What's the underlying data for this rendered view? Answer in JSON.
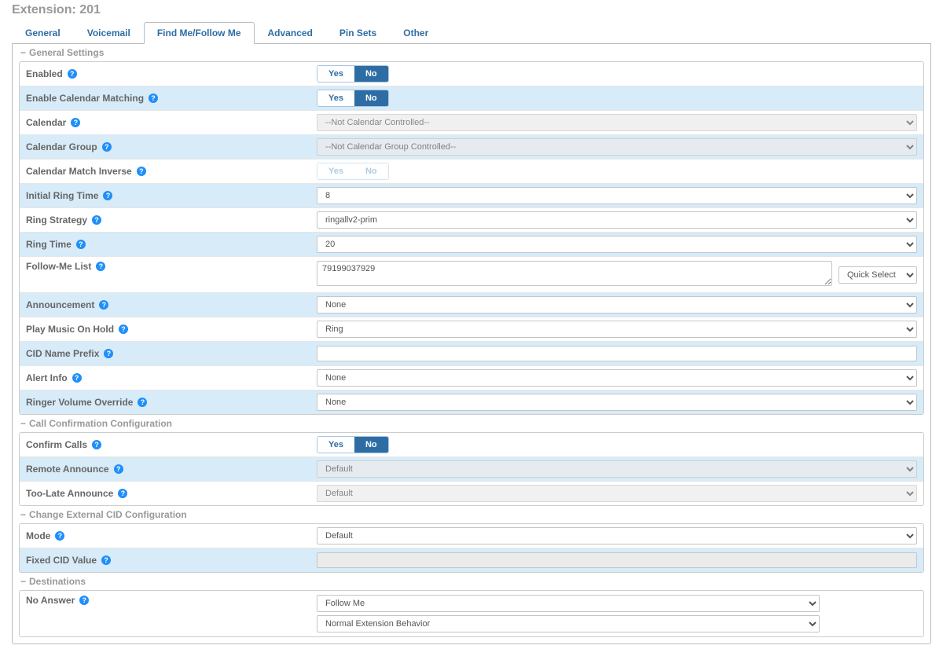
{
  "page_title": "Extension: 201",
  "tabs": {
    "general": "General",
    "voicemail": "Voicemail",
    "findme": "Find Me/Follow Me",
    "advanced": "Advanced",
    "pinsets": "Pin Sets",
    "other": "Other"
  },
  "yn": {
    "yes": "Yes",
    "no": "No"
  },
  "sections": {
    "general": {
      "title": "General Settings",
      "enabled": "Enabled",
      "cal_match": "Enable Calendar Matching",
      "calendar": "Calendar",
      "calendar_val": "--Not Calendar Controlled--",
      "cal_group": "Calendar Group",
      "cal_group_val": "--Not Calendar Group Controlled--",
      "cal_inverse": "Calendar Match Inverse",
      "init_ring": "Initial Ring Time",
      "init_ring_val": "8",
      "ring_strategy": "Ring Strategy",
      "ring_strategy_val": "ringallv2-prim",
      "ring_time": "Ring Time",
      "ring_time_val": "20",
      "follow_list": "Follow-Me List",
      "follow_list_val": "79199037929",
      "quick_select": "Quick Select",
      "announcement": "Announcement",
      "announcement_val": "None",
      "moh": "Play Music On Hold",
      "moh_val": "Ring",
      "cid_prefix": "CID Name Prefix",
      "cid_prefix_val": "",
      "alert_info": "Alert Info",
      "alert_info_val": "None",
      "ringer_vol": "Ringer Volume Override",
      "ringer_vol_val": "None"
    },
    "confirm": {
      "title": "Call Confirmation Configuration",
      "confirm_calls": "Confirm Calls",
      "remote_announce": "Remote Announce",
      "remote_announce_val": "Default",
      "toolate": "Too-Late Announce",
      "toolate_val": "Default"
    },
    "extcid": {
      "title": "Change External CID Configuration",
      "mode": "Mode",
      "mode_val": "Default",
      "fixed_cid": "Fixed CID Value",
      "fixed_cid_val": ""
    },
    "dest": {
      "title": "Destinations",
      "no_answer": "No Answer",
      "no_answer_val1": "Follow Me",
      "no_answer_val2": "Normal Extension Behavior"
    }
  }
}
